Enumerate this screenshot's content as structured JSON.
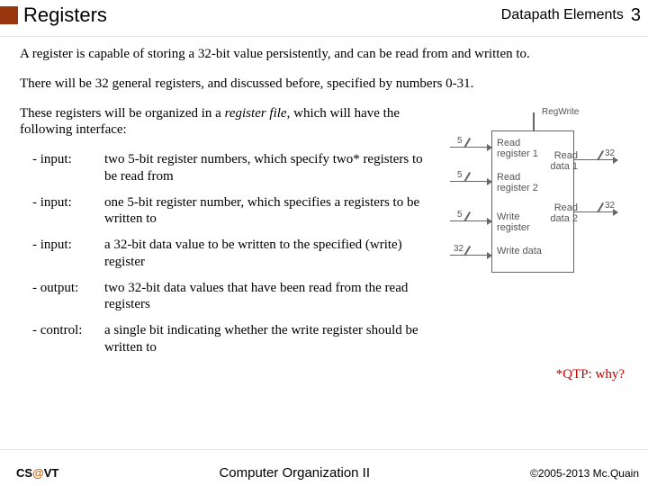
{
  "header": {
    "title": "Registers",
    "subtitle": "Datapath Elements",
    "slide_num": "3"
  },
  "body": {
    "p1": "A register is capable of storing a 32-bit value persistently, and can be read from and written to.",
    "p2": "There will be 32 general registers, and discussed before, specified by numbers 0-31.",
    "p3a": "These registers will be organized in a ",
    "p3_em": "register file",
    "p3b": ", which will have the following interface:"
  },
  "defs": [
    {
      "k": "-  input:",
      "v": "two 5-bit register numbers, which specify two* registers to be read from"
    },
    {
      "k": "-  input:",
      "v": "one 5-bit register number, which specifies a registers to be written to"
    },
    {
      "k": "-  input:",
      "v": "a 32-bit data value to be written to the specified (write) register"
    },
    {
      "k": "-  output:",
      "v": "two 32-bit data values that have been read from the read registers"
    },
    {
      "k": "-  control:",
      "v": "a single bit indicating whether the write register should be written to"
    }
  ],
  "qtp": "*QTP:  why?",
  "diagram": {
    "top": "RegWrite",
    "in1": "Read register 1",
    "in2": "Read register 2",
    "in3": "Write register",
    "in4": "Write data",
    "out1": "Read data 1",
    "out2": "Read data 2",
    "w5": "5",
    "w32": "32"
  },
  "footer": {
    "left_a": "CS",
    "left_at": "@",
    "left_b": "VT",
    "center": "Computer Organization II",
    "right": "©2005-2013 Mc.Quain"
  }
}
